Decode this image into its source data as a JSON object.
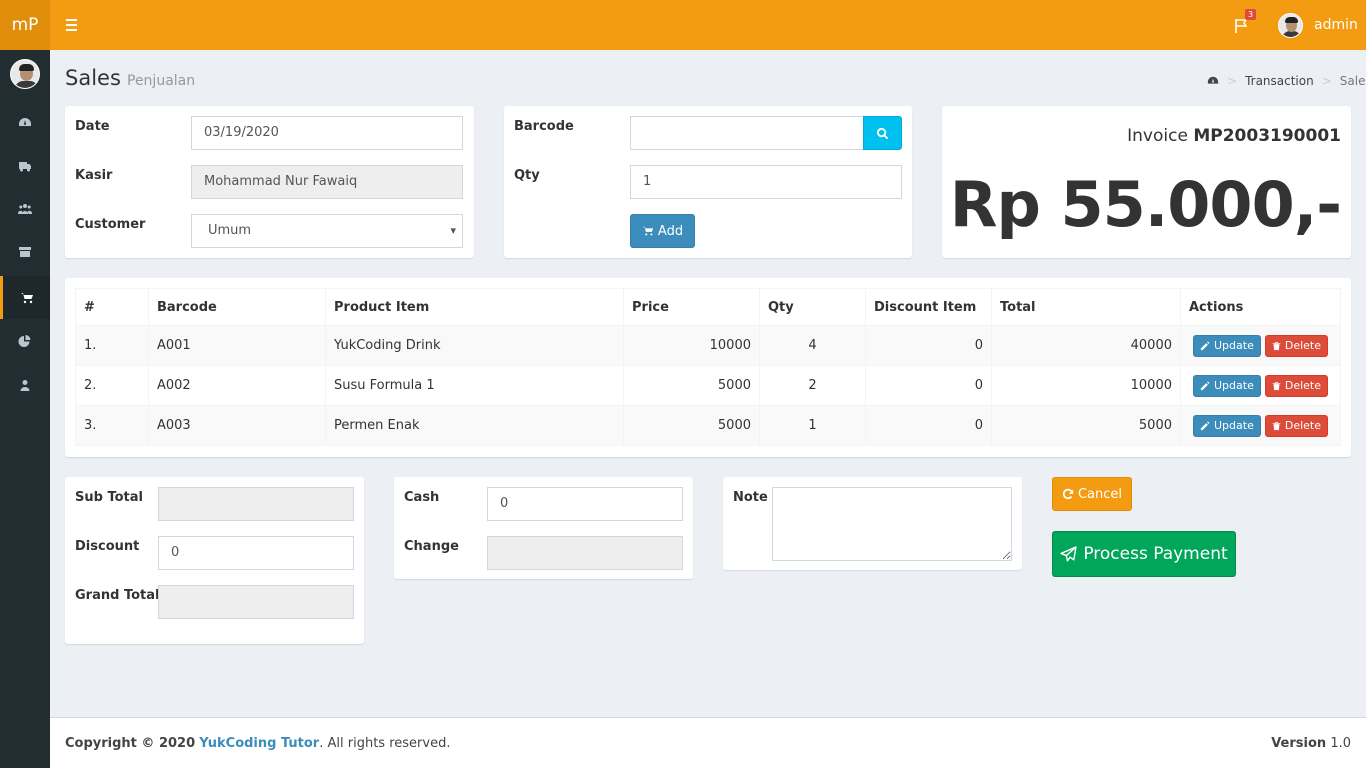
{
  "header": {
    "logo": "mP",
    "notification_count": "3",
    "user_name": "admin",
    "accent_color": "#f39c12"
  },
  "sidebar": {
    "items": [
      {
        "icon": "dashboard-icon",
        "active": false
      },
      {
        "icon": "truck-icon",
        "active": false
      },
      {
        "icon": "users-icon",
        "active": false
      },
      {
        "icon": "archive-icon",
        "active": false
      },
      {
        "icon": "cart-icon",
        "active": true
      },
      {
        "icon": "pie-chart-icon",
        "active": false
      },
      {
        "icon": "user-icon",
        "active": false
      }
    ]
  },
  "page": {
    "title": "Sales",
    "subtitle": "Penjualan",
    "breadcrumb": [
      "Transaction",
      "Sales"
    ]
  },
  "form": {
    "date_label": "Date",
    "date_value": "03/19/2020",
    "kasir_label": "Kasir",
    "kasir_value": "Mohammad Nur Fawaiq",
    "customer_label": "Customer",
    "customer_value": "Umum",
    "barcode_label": "Barcode",
    "barcode_value": "",
    "qty_label": "Qty",
    "qty_value": "1",
    "add_label": "Add"
  },
  "invoice": {
    "label": "Invoice",
    "number": "MP2003190001",
    "total": "Rp 55.000,-"
  },
  "table": {
    "headers": [
      "#",
      "Barcode",
      "Product Item",
      "Price",
      "Qty",
      "Discount Item",
      "Total",
      "Actions"
    ],
    "rows": [
      {
        "no": "1.",
        "barcode": "A001",
        "item": "YukCoding Drink",
        "price": "10000",
        "qty": "4",
        "discount": "0",
        "total": "40000"
      },
      {
        "no": "2.",
        "barcode": "A002",
        "item": "Susu Formula 1",
        "price": "5000",
        "qty": "2",
        "discount": "0",
        "total": "10000"
      },
      {
        "no": "3.",
        "barcode": "A003",
        "item": "Permen Enak",
        "price": "5000",
        "qty": "1",
        "discount": "0",
        "total": "5000"
      }
    ],
    "update_label": "Update",
    "delete_label": "Delete"
  },
  "totals": {
    "subtotal_label": "Sub Total",
    "subtotal_value": "",
    "discount_label": "Discount",
    "discount_value": "0",
    "grandtotal_label": "Grand Total",
    "grandtotal_value": "",
    "cash_label": "Cash",
    "cash_value": "0",
    "change_label": "Change",
    "change_value": "",
    "note_label": "Note",
    "cancel_label": "Cancel",
    "process_label": "Process Payment"
  },
  "footer": {
    "copyright_prefix": "Copyright © 2020",
    "company": "YukCoding Tutor",
    "rights": ". All rights reserved.",
    "version_label": "Version",
    "version_value": "1.0"
  }
}
